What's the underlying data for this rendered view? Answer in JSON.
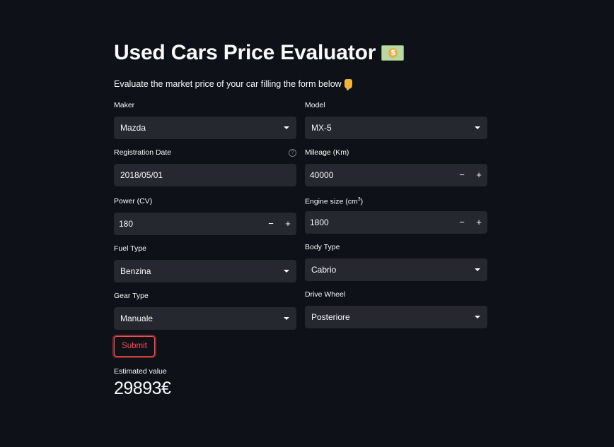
{
  "header": {
    "title": "Used Cars Price Evaluator",
    "title_emoji": "money-with-wings-icon",
    "subtitle": "Evaluate the market price of your car filling the form below",
    "subtitle_emoji": "pointing-down-icon"
  },
  "form": {
    "maker": {
      "label": "Maker",
      "value": "Mazda"
    },
    "model": {
      "label": "Model",
      "value": "MX-5"
    },
    "registration_date": {
      "label": "Registration Date",
      "value": "2018/05/01",
      "help": "?"
    },
    "mileage": {
      "label": "Mileage (Km)",
      "value": "40000"
    },
    "power": {
      "label": "Power (CV)",
      "value": "180"
    },
    "engine_size": {
      "label": "Engine size (cm",
      "label_sup": "3",
      "label_end": ")",
      "value": "1800"
    },
    "fuel_type": {
      "label": "Fuel Type",
      "value": "Benzina"
    },
    "body_type": {
      "label": "Body Type",
      "value": "Cabrio"
    },
    "gear_type": {
      "label": "Gear Type",
      "value": "Manuale"
    },
    "drive_wheel": {
      "label": "Drive Wheel",
      "value": "Posteriore"
    },
    "stepper_minus": "−",
    "stepper_plus": "+",
    "submit_label": "Submit"
  },
  "result": {
    "label": "Estimated value",
    "value": "29893€"
  },
  "colors": {
    "background": "#0e1117",
    "input_bg": "#262730",
    "accent": "#ff4b4b",
    "text": "#fafafa"
  }
}
